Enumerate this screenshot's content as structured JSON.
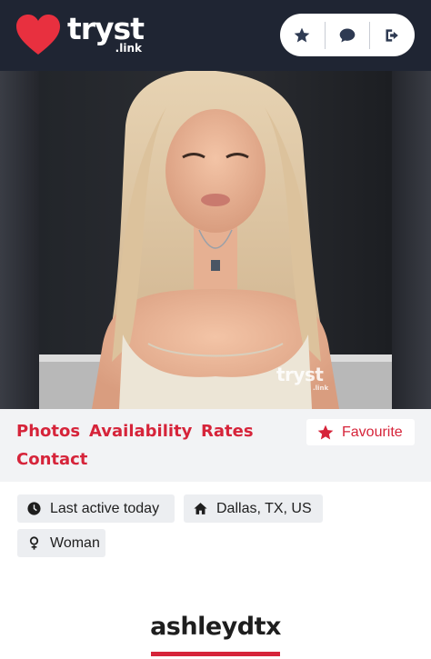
{
  "header": {
    "logo_word": "tryst",
    "logo_sub": ".link",
    "brand_color": "#e8303f",
    "background": "#1f2533",
    "nav_icons": [
      "star-icon",
      "chat-bubble-icon",
      "logout-icon"
    ]
  },
  "hero": {
    "watermark_word": "tryst",
    "watermark_sub": ".link"
  },
  "tabs": {
    "photos": "Photos",
    "availability": "Availability",
    "rates": "Rates",
    "contact": "Contact"
  },
  "favourite": {
    "label": "Favourite",
    "icon": "star-icon"
  },
  "info": {
    "last_active": "Last active today",
    "location": "Dallas, TX, US",
    "gender": "Woman"
  },
  "profile": {
    "username": "ashleydtx"
  },
  "colors": {
    "accent": "#d6243a",
    "chip_bg": "#eceef1",
    "tabs_bg": "#f2f3f5"
  }
}
